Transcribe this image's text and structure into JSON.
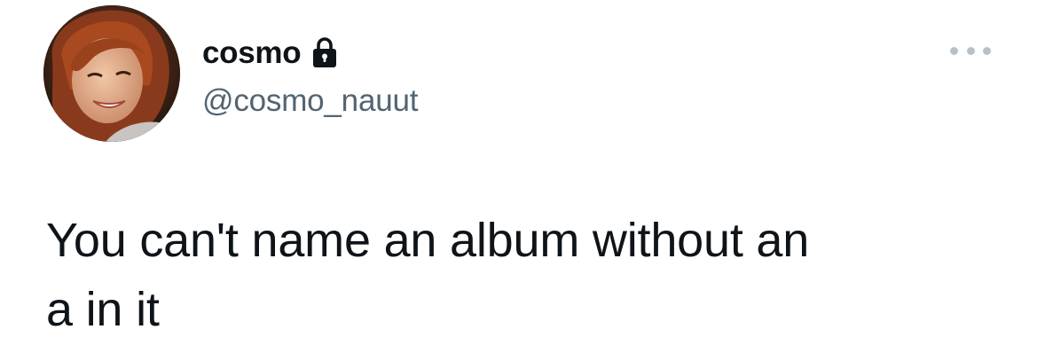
{
  "tweet": {
    "author": {
      "display_name": "cosmo",
      "handle": "@cosmo_nauut",
      "protected_icon": "lock-icon",
      "avatar": "profile-photo"
    },
    "more_icon": "more-horizontal-icon",
    "text_line_1": "You can't name an album without an",
    "text_line_2": "a in it"
  },
  "colors": {
    "text_primary": "#0f1419",
    "text_secondary": "#536471",
    "icon_muted": "#b9c0c6",
    "background": "#ffffff"
  }
}
